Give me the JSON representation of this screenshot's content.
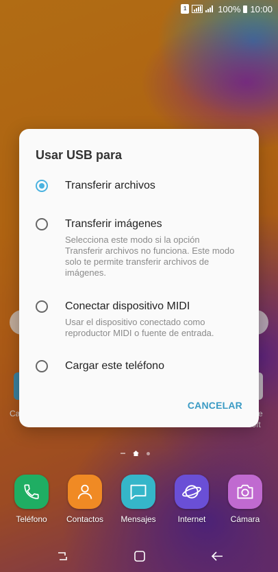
{
  "status_bar": {
    "sim_label": "1",
    "battery": "100%",
    "time": "10:00"
  },
  "dialog": {
    "title": "Usar USB para",
    "options": [
      {
        "label": "Transferir archivos",
        "description": "",
        "selected": true
      },
      {
        "label": "Transferir imágenes",
        "description": "Selecciona este modo si la opción Transferir archivos no funciona. Este modo solo te permite transferir archivos de imágenes.",
        "selected": false
      },
      {
        "label": "Conectar dispositivo MIDI",
        "description": "Usar el dispositivo conectado como reproductor MIDI o fuente de entrada.",
        "selected": false
      },
      {
        "label": "Cargar este teléfono",
        "description": "",
        "selected": false
      }
    ],
    "cancel_label": "CANCELAR"
  },
  "background": {
    "left_label": "Ca",
    "right_label_line1": "e",
    "right_label_line2": "Microsoft"
  },
  "dock": {
    "apps": [
      {
        "label": "Teléfono",
        "icon": "phone-icon",
        "color": "#1fae63"
      },
      {
        "label": "Contactos",
        "icon": "contacts-icon",
        "color": "#f08a24"
      },
      {
        "label": "Mensajes",
        "icon": "messages-icon",
        "color": "#35b6c9"
      },
      {
        "label": "Internet",
        "icon": "internet-icon",
        "color": "#6a4fd6"
      },
      {
        "label": "Cámara",
        "icon": "camera-icon",
        "color": "#c06ad0"
      }
    ]
  },
  "navigation": {
    "recents": "recents-icon",
    "home": "home-icon",
    "back": "back-icon"
  },
  "colors": {
    "accent": "#4ab2e0",
    "cancel": "#3a9ac4"
  }
}
